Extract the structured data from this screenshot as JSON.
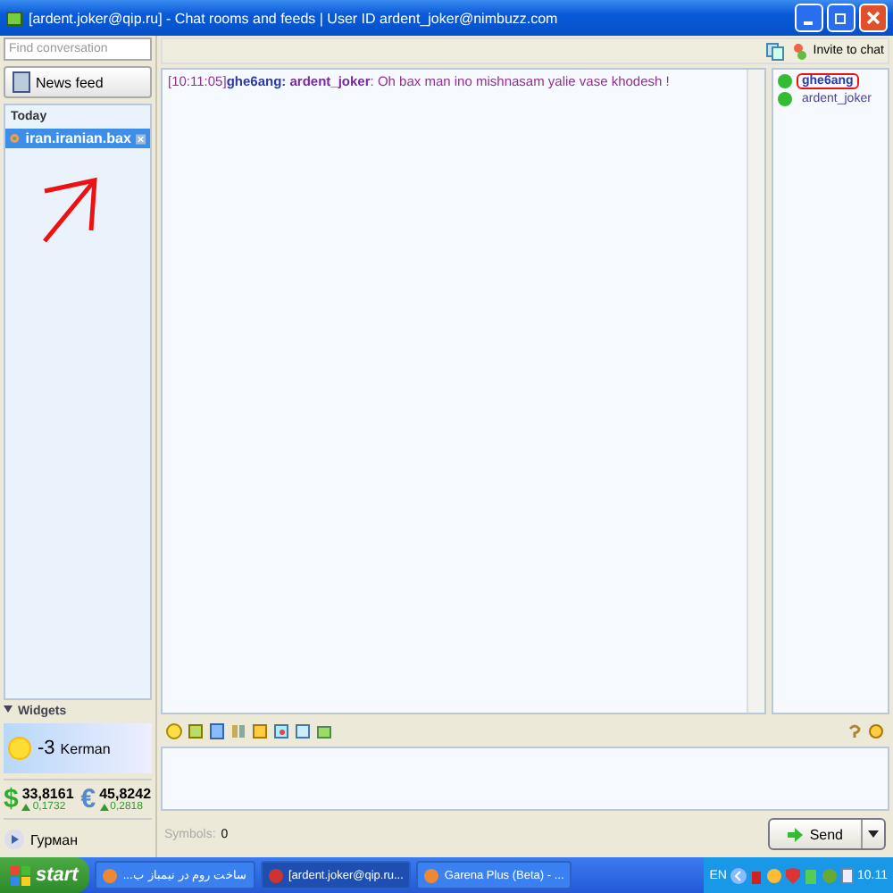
{
  "window": {
    "title": "[ardent.joker@qip.ru] - Chat rooms and feeds | User ID ardent_joker@nimbuzz.com"
  },
  "sidebar": {
    "search": {
      "placeholder": "Find conversation"
    },
    "news_feed": "News feed",
    "section": "Today",
    "conversations": [
      {
        "name": "iran.iranian.bax",
        "selected": true
      }
    ]
  },
  "toolbar": {
    "invite": "Invite to chat"
  },
  "messages": [
    {
      "time": "[10:11:05]",
      "sender": "ghe6ang:",
      "recipient": "ardent_joker",
      "text": ": Oh bax man ino mishnasam yalie vase khodesh !"
    }
  ],
  "participants": [
    {
      "name": "ghe6ang",
      "highlighted": true
    },
    {
      "name": "ardent_joker",
      "highlighted": false
    }
  ],
  "widgets": {
    "header": "Widgets",
    "temperature": "-3",
    "city": "Kerman",
    "currencies": [
      {
        "symbol": "$",
        "value": "33,8161",
        "change": "0,1732"
      },
      {
        "symbol": "€",
        "value": "45,8242",
        "change": "0,2818"
      }
    ],
    "player": "Гурман"
  },
  "composer": {
    "symbols_label": "Symbols:",
    "symbols_count": "0",
    "send": "Send"
  },
  "taskbar": {
    "start": "start",
    "items": [
      {
        "label": "ساخت روم در نیمباز ب...",
        "selected": false
      },
      {
        "label": "[ardent.joker@qip.ru...",
        "selected": true
      },
      {
        "label": "Garena Plus (Beta) - ...",
        "selected": false
      }
    ],
    "language": "EN",
    "clock": "10.11"
  }
}
